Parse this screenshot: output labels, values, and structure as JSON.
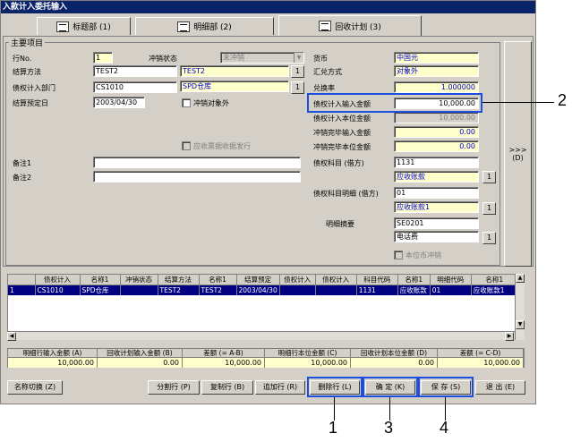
{
  "window": {
    "title": "入款计入委托输入"
  },
  "tabs": [
    {
      "label": "标题部 (1)"
    },
    {
      "label": "明细部 (2)"
    },
    {
      "label": "回收计划 (3)"
    }
  ],
  "group_title": "主要项目",
  "left": {
    "row_no_label": "行No.",
    "row_no_value": "1",
    "status_label": "冲销状态",
    "status_value": "未冲销",
    "method_label": "结算方法",
    "method_code": "TEST2",
    "method_name": "TEST2",
    "dept_label": "债权计入部门",
    "dept_code": "CS1010",
    "dept_name": "SPD仓库",
    "date_label": "结算预定日",
    "date_value": "2003/04/30",
    "exclude_label": "冲销对象外",
    "receivable_label": "应收票据收据发行",
    "note1_label": "备注1",
    "note2_label": "备注2",
    "lookup_label": "1"
  },
  "right": {
    "currency_label": "货币",
    "currency_value": "中国元",
    "exchange_label": "汇兑方式",
    "exchange_value": "对象外",
    "rate_label": "兑换率",
    "rate_value": "1.000000",
    "input_amt_label": "债权计入输入金额",
    "input_amt_value": "10,000.00",
    "base_amt_label": "债权计入本位金额",
    "base_amt_value": "10,000.00",
    "writeoff_input_label": "冲销完毕输入金额",
    "writeoff_input_value": "0.00",
    "writeoff_base_label": "冲销完毕本位金额",
    "writeoff_base_value": "0.00",
    "subject_label": "债权科目 (借方)",
    "subject_code": "1131",
    "subject_name": "应收账款",
    "subject_detail_label": "债权科目明细 (借方)",
    "subject_detail_code": "01",
    "subject_detail_name": "应收账款1",
    "summary_label": "明细摘要",
    "summary_code": "SE0201",
    "summary_name": "电话费",
    "base_writeoff_label": "本位币冲销"
  },
  "side_button": {
    "label": "(D)"
  },
  "grid": {
    "headers": [
      "债权计入",
      "名称1",
      "冲销状态",
      "结算方法",
      "名称1",
      "结算预定",
      "债权计入",
      "债权计入",
      "科目代码",
      "名称1",
      "明细代码",
      "名称1"
    ],
    "rows": [
      [
        "1",
        "CS1010",
        "SPD仓库",
        "",
        "TEST2",
        "TEST2",
        "2003/04/30",
        "",
        "",
        "1131",
        "应收账款",
        "01",
        "应收账款1"
      ]
    ]
  },
  "summary": {
    "headers": [
      "明细行输入金额 (A)",
      "回收计划输入金额 (B)",
      "差额 (= A-B)",
      "明细行本位金额 (C)",
      "回收计划本位金额 (D)",
      "差额 (= C-D)"
    ],
    "values": [
      "10,000.00",
      "0.00",
      "10,000.00",
      "10,000.00",
      "0.00",
      "10,000.00"
    ]
  },
  "buttons": {
    "name_switch": "名称切换 (Z)",
    "split_row": "分割行 (P)",
    "copy_row": "复制行 (B)",
    "add_row": "追加行 (R)",
    "delete_row": "删除行 (L)",
    "confirm": "确 定 (K)",
    "save": "保 存 (S)",
    "exit": "退 出 (E)"
  },
  "callouts": [
    "1",
    "2",
    "3",
    "4"
  ],
  "colors": {
    "titlebar": "#0a246a",
    "highlight": "#1c4fe0",
    "field_yellow": "#ffffcc",
    "face": "#d4d0c8"
  }
}
